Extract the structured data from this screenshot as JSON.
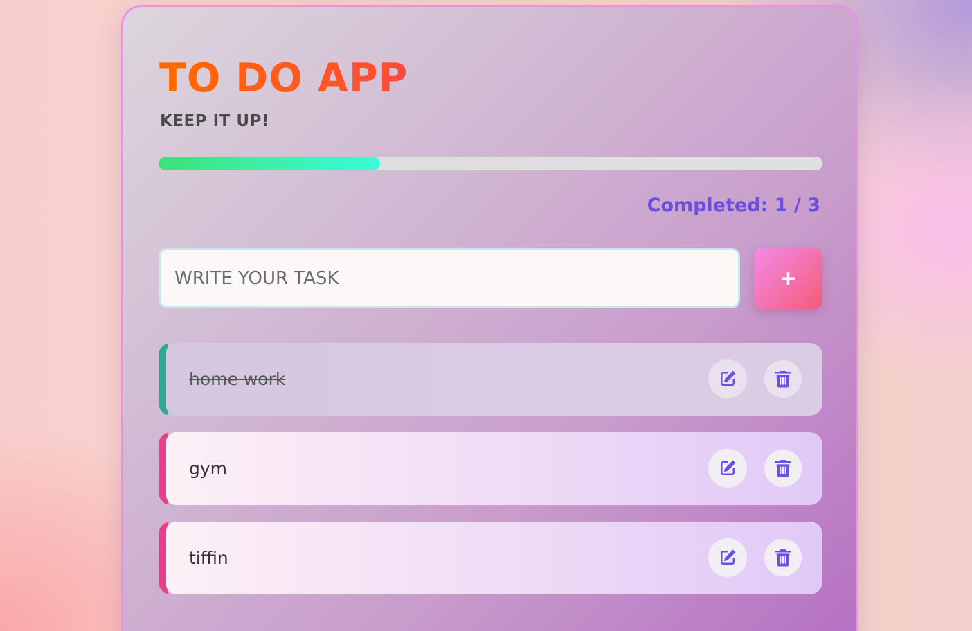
{
  "app": {
    "title": "TO DO APP",
    "subtitle": "KEEP IT UP!"
  },
  "progress": {
    "fraction": 0.3333,
    "completed_text": "Completed: 1 / 3"
  },
  "input": {
    "placeholder": "WRITE YOUR TASK",
    "value": ""
  },
  "add_button": {
    "label": "+"
  },
  "tasks": [
    {
      "text": "home work",
      "completed": true
    },
    {
      "text": "gym",
      "completed": false
    },
    {
      "text": "tiffin",
      "completed": false
    }
  ],
  "icons": {
    "edit": "edit-icon",
    "delete": "trash-icon"
  },
  "colors": {
    "title_gradient_start": "#ff6a00",
    "title_gradient_end": "#ff4b3a",
    "accent_purple": "#6a4fe0",
    "progress_start": "#3de27a",
    "progress_end": "#3afcd9",
    "done_accent": "#34a88f",
    "active_accent": "#e4418c"
  }
}
